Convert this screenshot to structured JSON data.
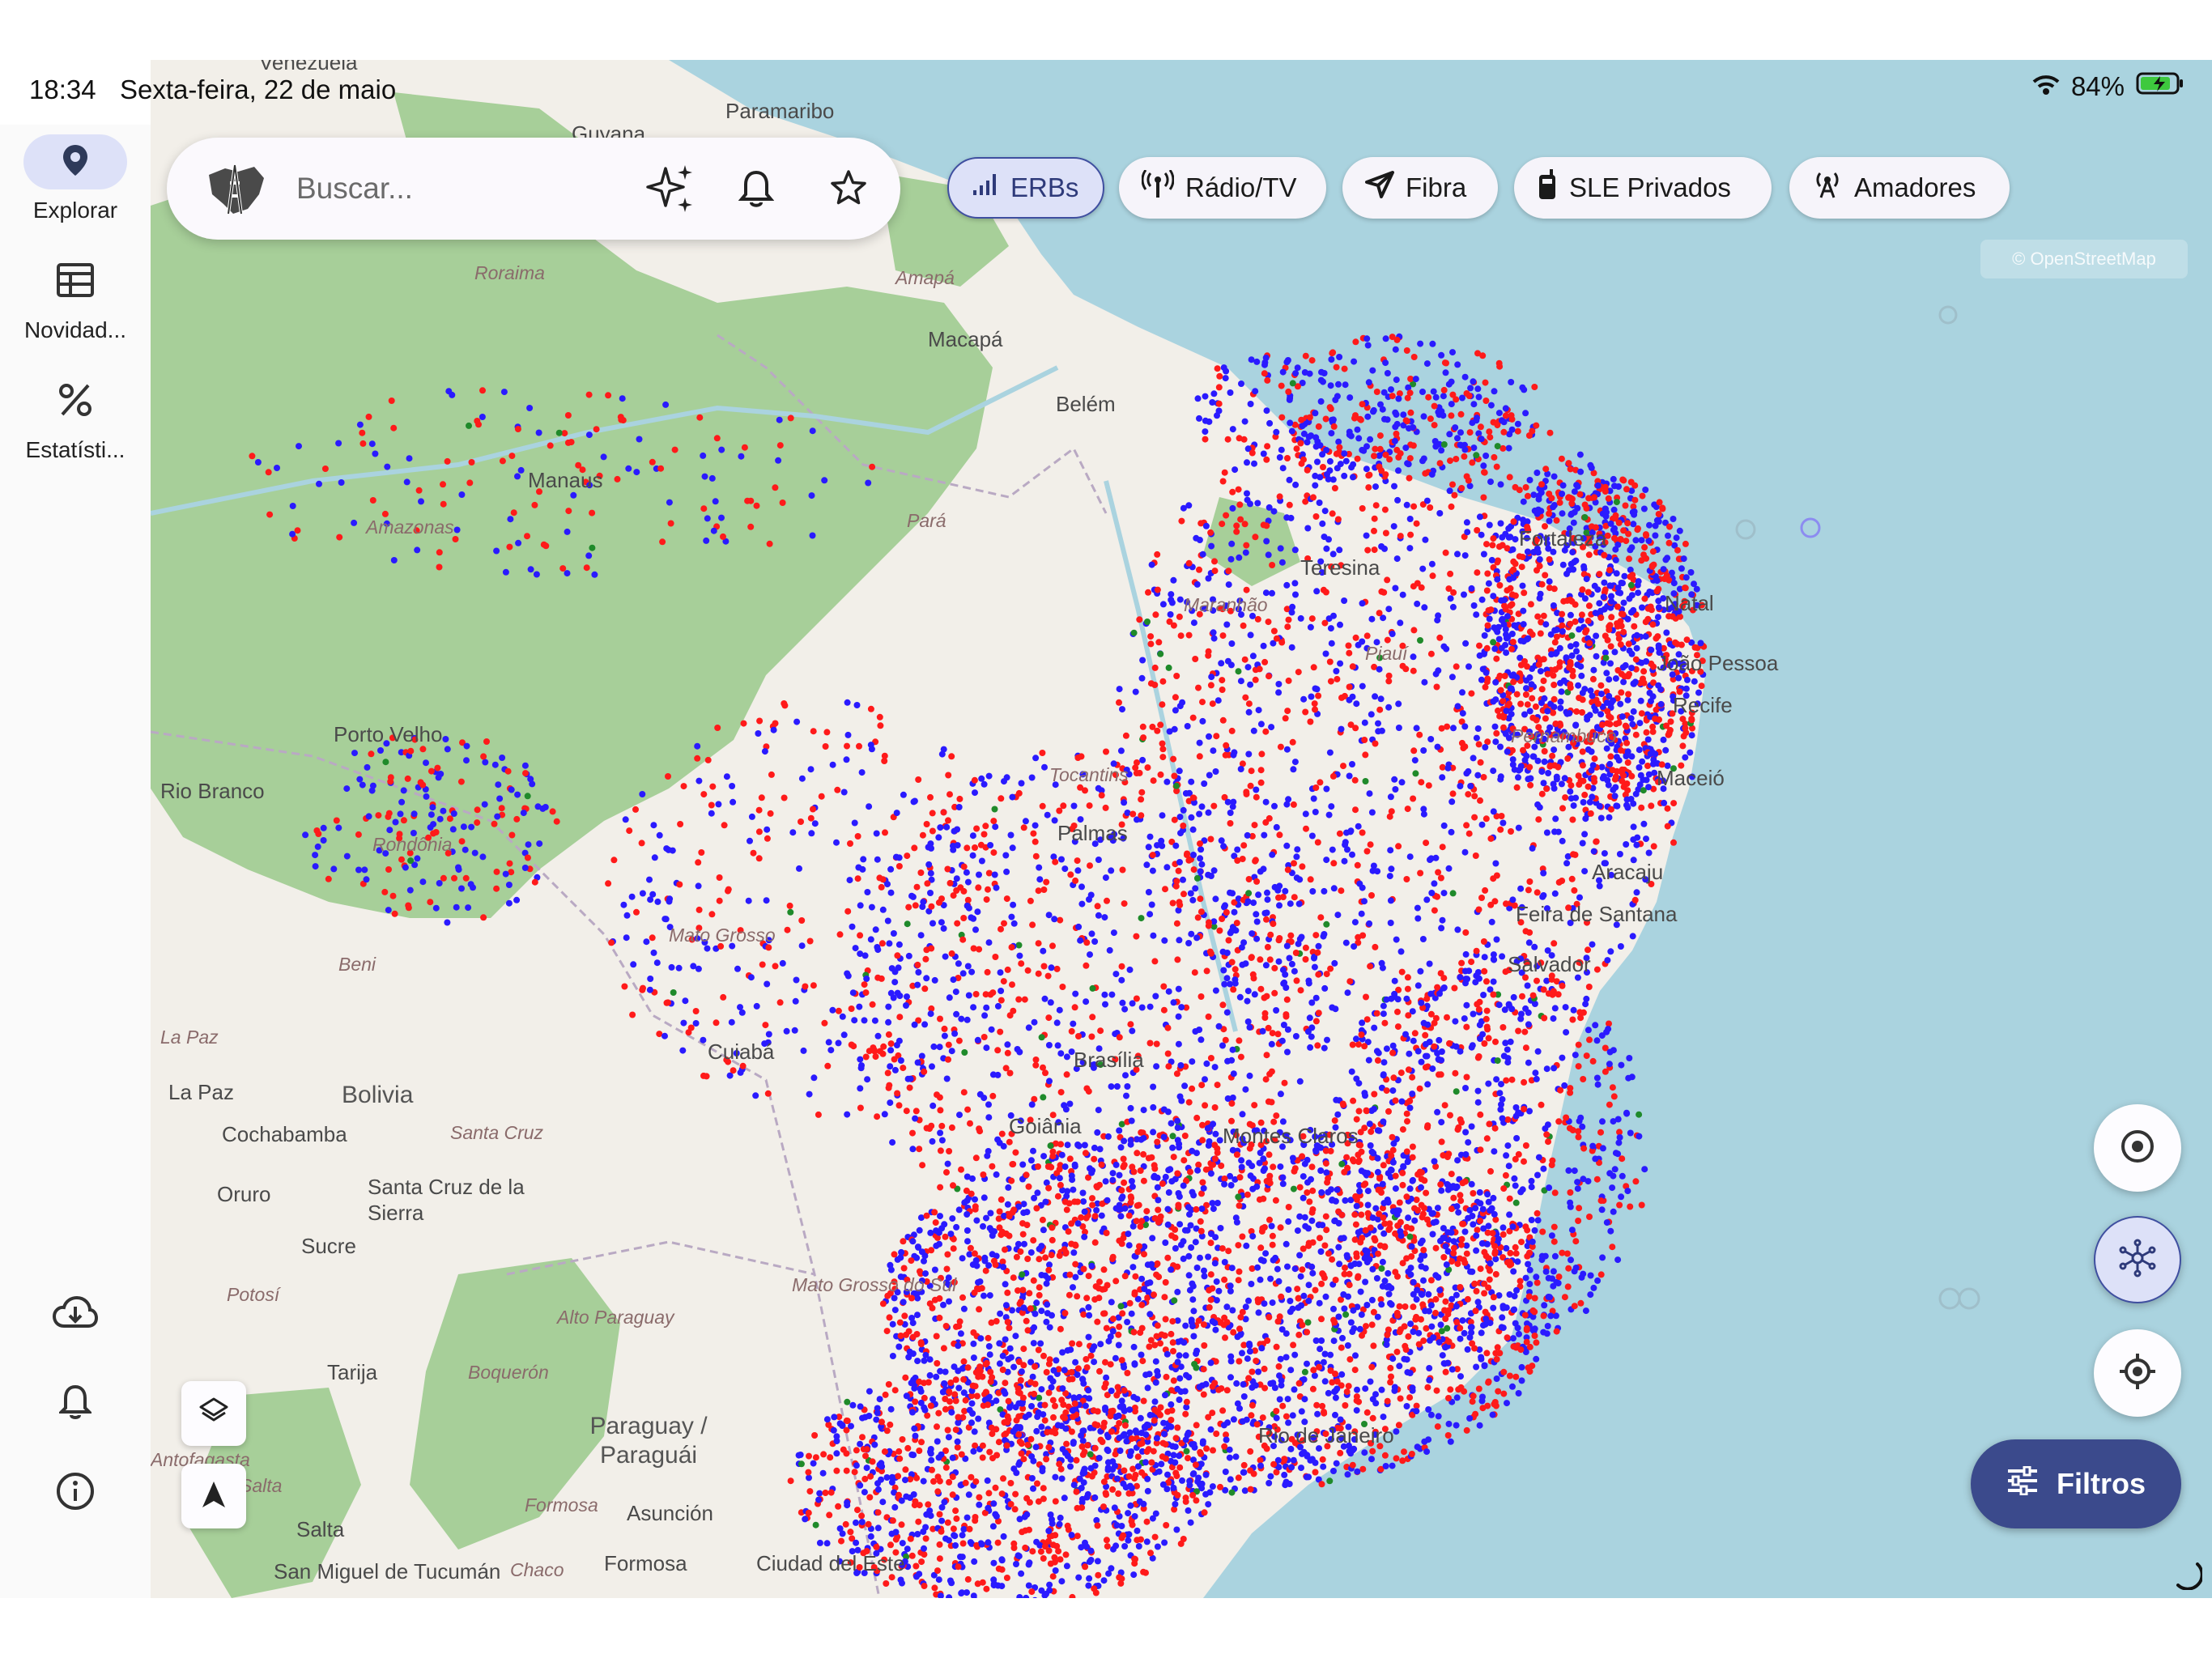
{
  "status_bar": {
    "time": "18:34",
    "date": "Sexta-feira, 22 de maio",
    "battery": "84%"
  },
  "nav_rail": {
    "items": [
      {
        "label": "Explorar",
        "icon": "map-pin-icon",
        "active": true
      },
      {
        "label": "Novidad...",
        "icon": "newspaper-icon",
        "active": false
      },
      {
        "label": "Estatísti...",
        "icon": "percent-icon",
        "active": false
      }
    ],
    "bottom_icons": [
      "cloud-download-icon",
      "bell-icon",
      "info-icon"
    ]
  },
  "search": {
    "placeholder": "Buscar..."
  },
  "layer_chips": [
    {
      "label": "ERBs",
      "icon": "signal-bars-icon",
      "active": true
    },
    {
      "label": "Rádio/TV",
      "icon": "antenna-icon",
      "active": false
    },
    {
      "label": "Fibra",
      "icon": "fiber-icon",
      "active": false
    },
    {
      "label": "SLE Privados",
      "icon": "walkie-talkie-icon",
      "active": false
    },
    {
      "label": "Amadores",
      "icon": "radio-tower-icon",
      "active": false
    }
  ],
  "map": {
    "attribution": "© OpenStreetMap",
    "colors": {
      "ocean": "#aad3df",
      "land": "#f2efe9",
      "forest": "#a7cf99",
      "marker_red": "#ff1a1a",
      "marker_blue": "#2a1aff",
      "marker_green": "#1f8a2a"
    },
    "place_labels": {
      "venezuela": "Venezuela",
      "paramaribo": "Paramaribo",
      "guyana": "Guyana",
      "roraima": "Roraima",
      "amapa": "Amapá",
      "macapa": "Macapá",
      "belem": "Belém",
      "manaus": "Manaus",
      "amazonas": "Amazonas",
      "para": "Pará",
      "fortaleza": "Fortaleza",
      "natal": "Natal",
      "joao_pessoa": "João Pessoa",
      "recife": "Recife",
      "maceio": "Maceió",
      "aracaju": "Aracaju",
      "feira": "Feira de Santana",
      "salvador": "Salvador",
      "teresina": "Teresina",
      "maranhao": "Maranhão",
      "piaui": "Piauí",
      "pernambuco": "Pernambuco",
      "tocantins": "Tocantins",
      "palmas": "Palmas",
      "porto_velho": "Porto Velho",
      "rio_branco": "Rio Branco",
      "rondonia": "Rondônia",
      "mato_grosso": "Mato Grosso",
      "beni": "Beni",
      "la_paz_dept": "La Paz",
      "la_paz": "La Paz",
      "bolivia": "Bolivia",
      "cochabamba": "Cochabamba",
      "santa_cruz_dept": "Santa Cruz",
      "santa_cruz": "Santa Cruz de la Sierra",
      "oruro": "Oruro",
      "sucre": "Sucre",
      "potosi": "Potosí",
      "alto_paraguay": "Alto Paraguay",
      "boqueron": "Boquerón",
      "tarija": "Tarija",
      "paraguay": "Paraguay / Paraguái",
      "asuncion": "Asunción",
      "formosa_prov": "Formosa",
      "formosa": "Formosa",
      "salta_prov": "Salta",
      "salta": "Salta",
      "chaco": "Chaco",
      "san_miguel": "San Miguel de Tucumán",
      "ciudad_del_este": "Ciudad del Este",
      "antofagasta": "Antofagasta",
      "cuiaba": "Cuiabá",
      "brasilia": "Brasília",
      "goiania": "Goiânia",
      "montes_claros": "Montes Claros",
      "mato_grosso_sul": "Mato Grosso do Sul",
      "rio": "Rio de Janeiro"
    }
  },
  "map_controls": {
    "layers_icon": "layers-icon",
    "compass_icon": "navigation-arrow-icon",
    "right_buttons": [
      "target-circle-icon",
      "cluster-network-icon",
      "my-location-icon"
    ]
  },
  "filters": {
    "label": "Filtros",
    "icon": "sliders-icon"
  }
}
